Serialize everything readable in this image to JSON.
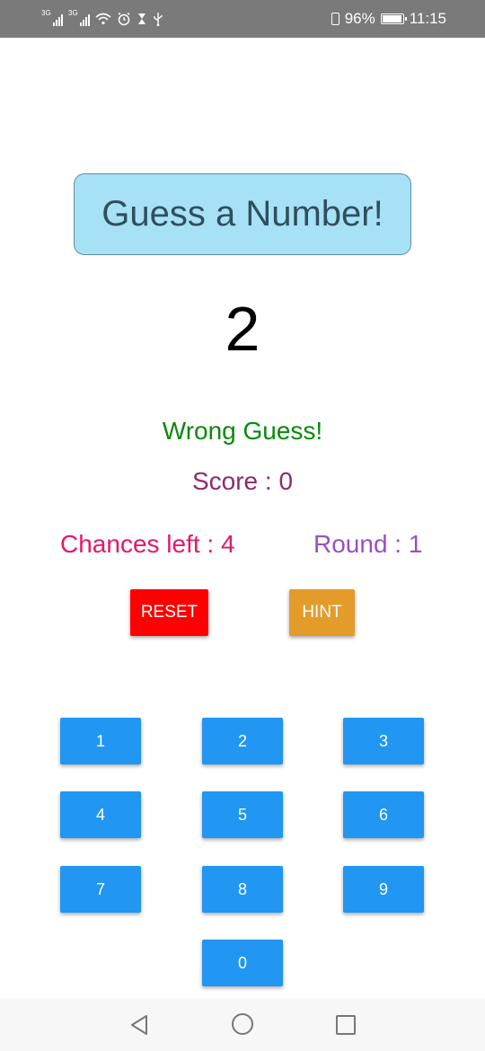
{
  "status_bar": {
    "signal1_label": "3G",
    "signal2_label": "3G",
    "battery_percent_text": "96%",
    "battery_level": 0.96,
    "time": "11:15",
    "icons": [
      "signal-icon",
      "signal-icon",
      "wifi-icon",
      "alarm-icon",
      "hourglass-icon",
      "usb-icon",
      "vibrate-icon",
      "battery-icon"
    ]
  },
  "game": {
    "title": "Guess a Number!",
    "current_guess": "2",
    "feedback": "Wrong Guess!",
    "score": "Score : 0",
    "chances": "Chances left : 4",
    "round": "Round : 1",
    "reset_label": "RESET",
    "hint_label": "HINT"
  },
  "keypad": {
    "keys": [
      "1",
      "2",
      "3",
      "4",
      "5",
      "6",
      "7",
      "8",
      "9",
      "0"
    ]
  },
  "colors": {
    "title_bg": "#a7e1f6",
    "feedback": "#0a8a0a",
    "score": "#8e2a71",
    "chances": "#e5176a",
    "round": "#9b4fc0",
    "reset": "#ff0000",
    "hint": "#e39b2a",
    "key": "#2196f3"
  },
  "nav_bar": {
    "icons": [
      "back-icon",
      "home-icon",
      "recent-apps-icon"
    ]
  }
}
